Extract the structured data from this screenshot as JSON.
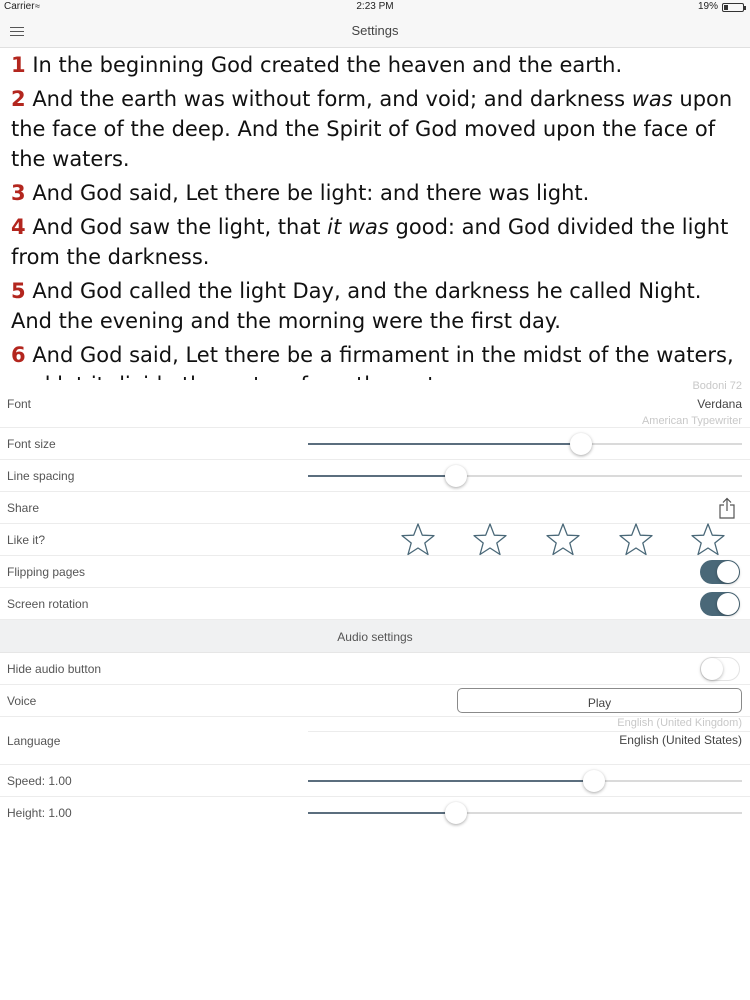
{
  "status_bar": {
    "carrier": "Carrier",
    "wifi_icon": "wifi-icon",
    "time": "2:23 PM",
    "battery_percent": "19%",
    "battery_level": 0.19
  },
  "nav": {
    "title": "Settings",
    "menu_icon": "hamburger-menu-icon"
  },
  "verses": [
    {
      "num": "1",
      "parts": [
        {
          "t": "In the beginning God created the heaven and the earth."
        }
      ]
    },
    {
      "num": "2",
      "parts": [
        {
          "t": "And the earth was without form, and void; and darkness "
        },
        {
          "t": "was",
          "i": true
        },
        {
          "t": " upon the face of the deep. And the Spirit of God moved upon the face of the waters."
        }
      ]
    },
    {
      "num": "3",
      "parts": [
        {
          "t": "And God said, Let there be light: and there was light."
        }
      ]
    },
    {
      "num": "4",
      "parts": [
        {
          "t": "And God saw the light, that "
        },
        {
          "t": "it was",
          "i": true
        },
        {
          "t": " good: and God divided the light from the darkness."
        }
      ]
    },
    {
      "num": "5",
      "parts": [
        {
          "t": "And God called the light Day, and the darkness he called Night. And the evening and the morning were the first day."
        }
      ]
    },
    {
      "num": "6",
      "parts": [
        {
          "t": "And God said, Let there be a firmament in the midst of the waters, and let it divide the waters from the waters."
        }
      ]
    }
  ],
  "settings": {
    "font": {
      "label": "Font",
      "options_above": "Bodoni 72",
      "selected": "Verdana",
      "options_below": "American Typewriter"
    },
    "font_size": {
      "label": "Font size",
      "level": 0.63
    },
    "line_spacing": {
      "label": "Line spacing",
      "level": 0.34
    },
    "share": {
      "label": "Share",
      "icon": "share-icon"
    },
    "like": {
      "label": "Like it?",
      "stars_total": 5,
      "stars_filled": 0,
      "icon": "star-icon"
    },
    "flipping_pages": {
      "label": "Flipping pages",
      "on": true
    },
    "screen_rotation": {
      "label": "Screen rotation",
      "on": true
    }
  },
  "audio": {
    "header": "Audio settings",
    "hide_audio_button": {
      "label": "Hide audio button",
      "on": false
    },
    "voice": {
      "label": "Voice",
      "button": "Play"
    },
    "language": {
      "label": "Language",
      "option_above": "English (United Kingdom)",
      "selected": "English (United States)"
    },
    "speed": {
      "label": "Speed: 1.00",
      "level": 0.66
    },
    "height": {
      "label": "Height: 1.00",
      "level": 0.34
    }
  },
  "colors": {
    "verse_number": "#b3261e",
    "toggle_on": "#4a6878",
    "slider_fill": "#5b6e7e"
  }
}
